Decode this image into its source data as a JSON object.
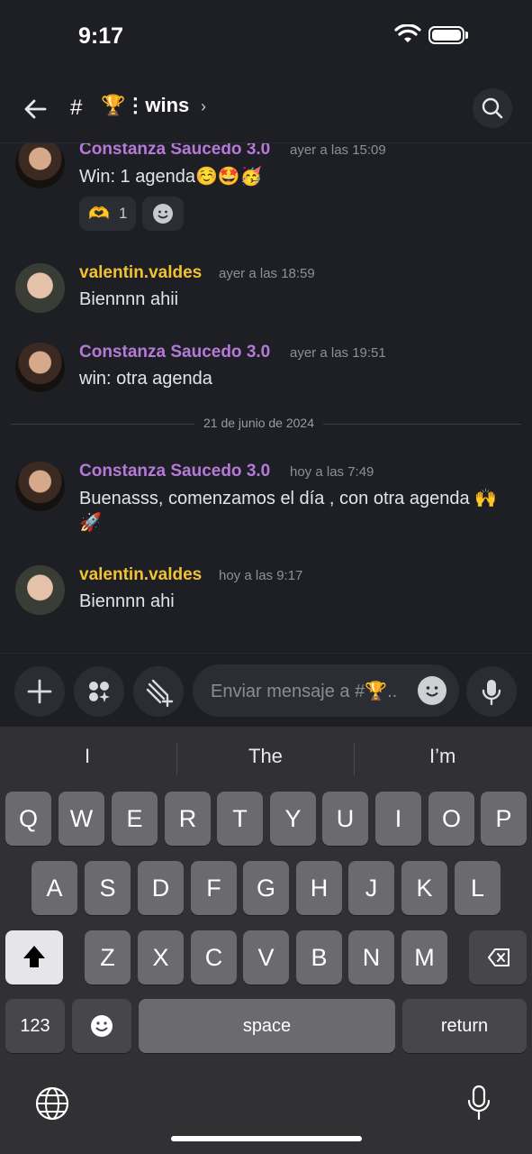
{
  "status": {
    "time": "9:17"
  },
  "header": {
    "channel_prefix": "#",
    "channel_name": "🏆⋮wins",
    "chevron": "›"
  },
  "messages": [
    {
      "author": "Constanza Saucedo 3.0",
      "timestamp": "ayer a las 15:09",
      "text": "Win: 1 agenda☺️🤩🥳",
      "reactions": [
        {
          "emoji": "🫶",
          "count": "1"
        }
      ]
    },
    {
      "author": "valentin.valdes",
      "timestamp": "ayer a las 18:59",
      "text": "Biennnn ahii"
    },
    {
      "author": "Constanza Saucedo 3.0",
      "timestamp": "ayer a las 19:51",
      "text": "win: otra agenda"
    },
    {
      "author": "Constanza Saucedo 3.0",
      "timestamp": "hoy a las 7:49",
      "text": "Buenasss, comenzamos el día , con otra agenda 🙌",
      "text2": "🚀"
    },
    {
      "author": "valentin.valdes",
      "timestamp": "hoy a las 9:17",
      "text": "Biennnn ahi"
    }
  ],
  "date_divider": "21 de junio de 2024",
  "composer": {
    "placeholder": "Enviar mensaje a #🏆.."
  },
  "keyboard": {
    "suggestions": [
      "I",
      "The",
      "I’m"
    ],
    "row1": [
      "Q",
      "W",
      "E",
      "R",
      "T",
      "Y",
      "U",
      "I",
      "O",
      "P"
    ],
    "row2": [
      "A",
      "S",
      "D",
      "F",
      "G",
      "H",
      "J",
      "K",
      "L"
    ],
    "row3": [
      "Z",
      "X",
      "C",
      "V",
      "B",
      "N",
      "M"
    ],
    "numbers_label": "123",
    "space_label": "space",
    "return_label": "return"
  }
}
